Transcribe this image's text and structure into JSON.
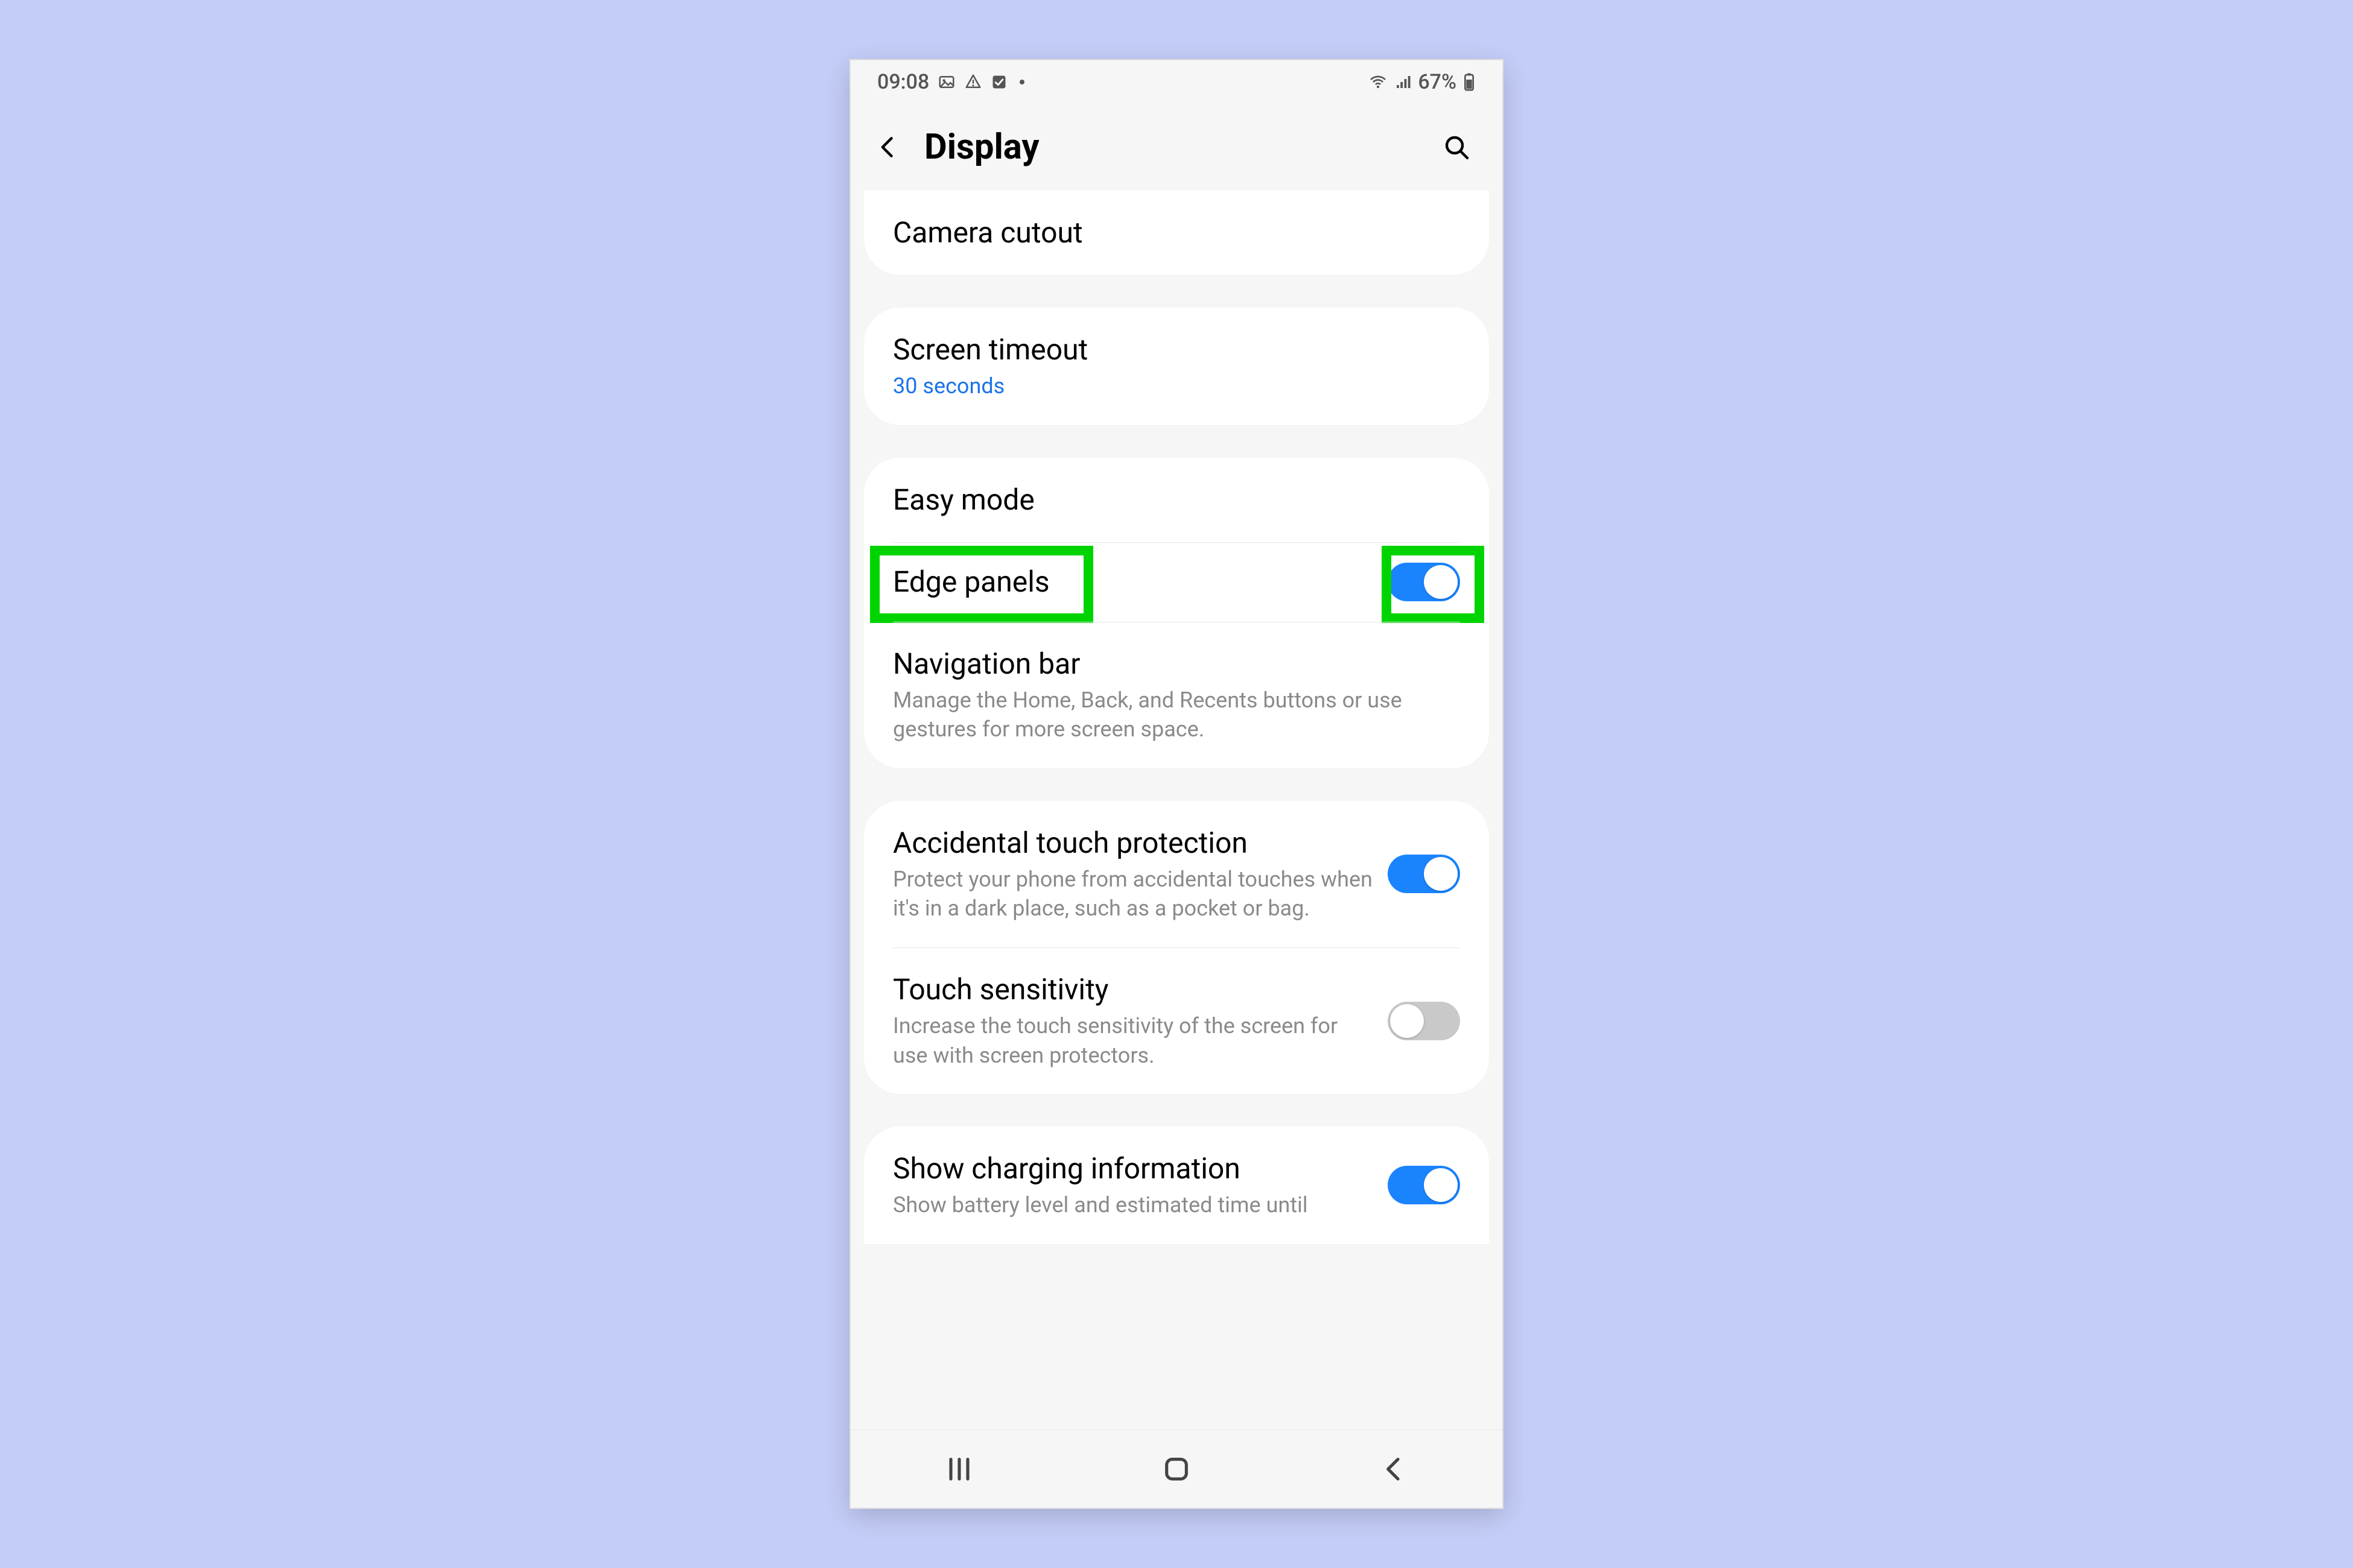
{
  "statusbar": {
    "time": "09:08",
    "battery_text": "67%",
    "icons_left": [
      "image-icon",
      "cloud-warning-icon",
      "checkbox-icon"
    ],
    "icons_right": [
      "wifi-icon",
      "signal-icon",
      "battery-icon"
    ]
  },
  "header": {
    "title": "Display"
  },
  "groups": [
    {
      "id": "g1",
      "first_cut": true,
      "rows": [
        {
          "id": "camera_cutout",
          "title": "Camera cutout"
        }
      ]
    },
    {
      "id": "g2",
      "rows": [
        {
          "id": "screen_timeout",
          "title": "Screen timeout",
          "sub": "30 seconds",
          "sub_link": true
        }
      ]
    },
    {
      "id": "g3",
      "rows": [
        {
          "id": "easy_mode",
          "title": "Easy mode"
        },
        {
          "id": "edge_panels",
          "title": "Edge panels",
          "toggle": true,
          "on": true,
          "highlight": true
        },
        {
          "id": "navigation_bar",
          "title": "Navigation bar",
          "sub": "Manage the Home, Back, and Recents buttons or use gestures for more screen space."
        }
      ]
    },
    {
      "id": "g4",
      "rows": [
        {
          "id": "accidental_touch",
          "title": "Accidental touch protection",
          "sub": "Protect your phone from accidental touches when it's in a dark place, such as a pocket or bag.",
          "toggle": true,
          "on": true
        },
        {
          "id": "touch_sensitivity",
          "title": "Touch sensitivity",
          "sub": "Increase the touch sensitivity of the screen for use with screen protectors.",
          "toggle": true,
          "on": false
        }
      ]
    },
    {
      "id": "g5",
      "last_cut": true,
      "rows": [
        {
          "id": "show_charging",
          "title": "Show charging information",
          "sub": "Show battery level and estimated time until",
          "toggle": true,
          "on": true
        }
      ]
    }
  ],
  "colors": {
    "page_bg": "#c4cdf7",
    "phone_bg": "#f6f6f6",
    "card_bg": "#ffffff",
    "accent": "#1a84ff",
    "link": "#1a73e8",
    "highlight": "#00d400"
  }
}
